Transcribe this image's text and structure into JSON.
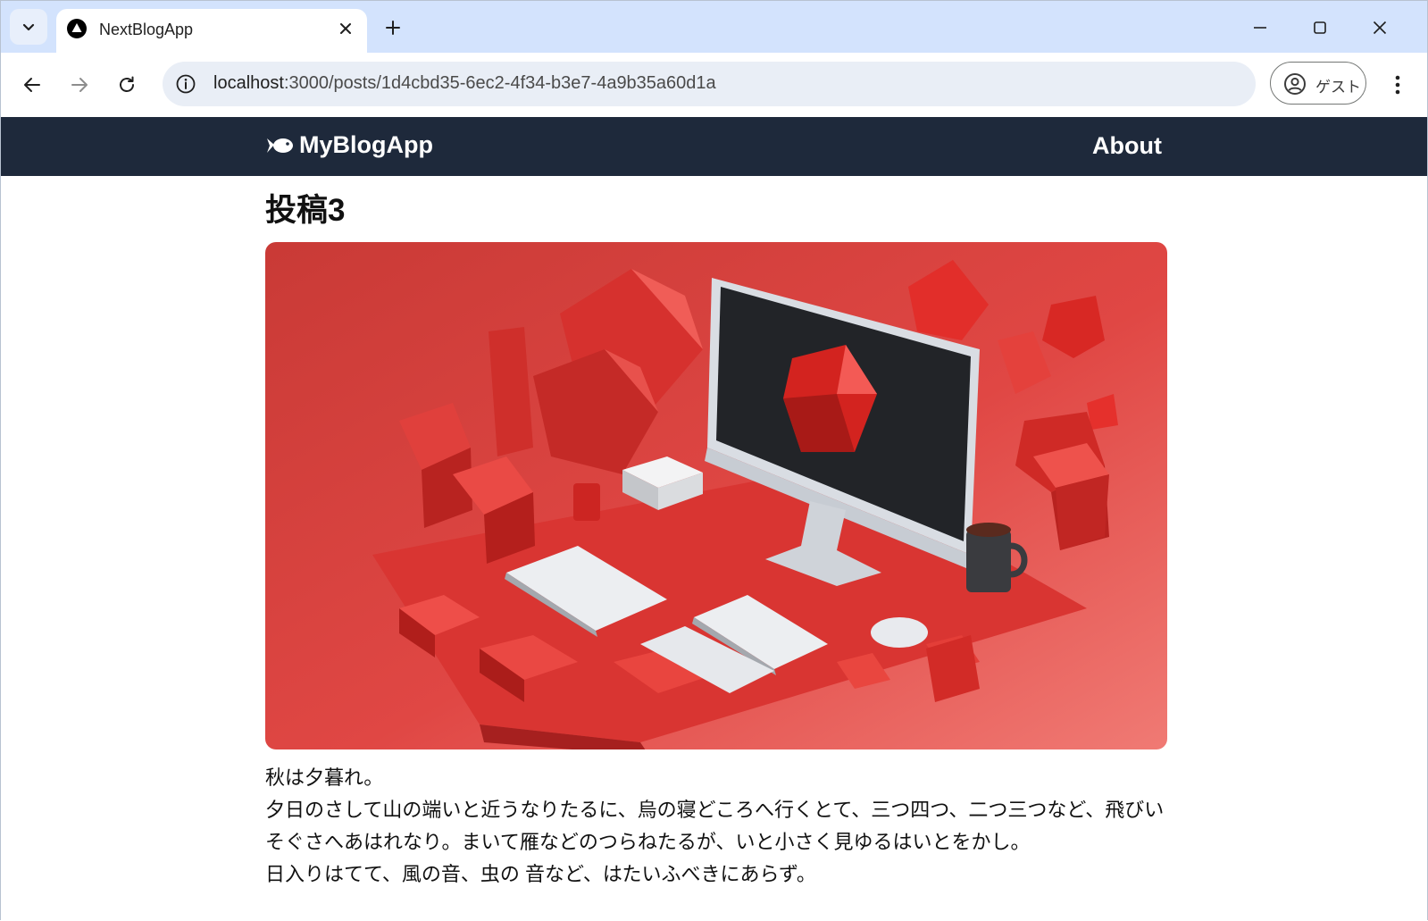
{
  "browser": {
    "tab": {
      "title": "NextBlogApp"
    },
    "address": {
      "host": "localhost",
      "path": ":3000/posts/1d4cbd35-6ec2-4f34-b3e7-4a9b35a60d1a"
    },
    "profile": {
      "label": "ゲスト"
    }
  },
  "site": {
    "brand": "MyBlogApp",
    "nav": {
      "about": "About"
    },
    "header_bg": "#1e293b"
  },
  "post": {
    "title": "投稿3",
    "paragraphs": [
      "秋は夕暮れ。",
      "夕日のさして山の端いと近うなりたるに、烏の寝どころへ行くとて、三つ四つ、二つ三つなど、飛びいそぐさへあはれなり。まいて雁などのつらねたるが、いと小さく見ゆるはいとをかし。",
      "日入りはてて、風の音、虫の 音など、はたいふべきにあらず。"
    ],
    "image_alt": "赤い幾何学オブジェクトに囲まれたデスクトップコンピューター"
  },
  "icons": {
    "tab_search": "chevron-down-icon",
    "favicon": "nextjs-triangle-icon",
    "close": "close-icon",
    "new_tab": "plus-icon",
    "back": "arrow-left-icon",
    "forward": "arrow-right-icon",
    "reload": "reload-icon",
    "site_info": "info-icon",
    "profile": "account-circle-icon",
    "menu": "more-vert-icon",
    "brand": "fish-icon"
  }
}
